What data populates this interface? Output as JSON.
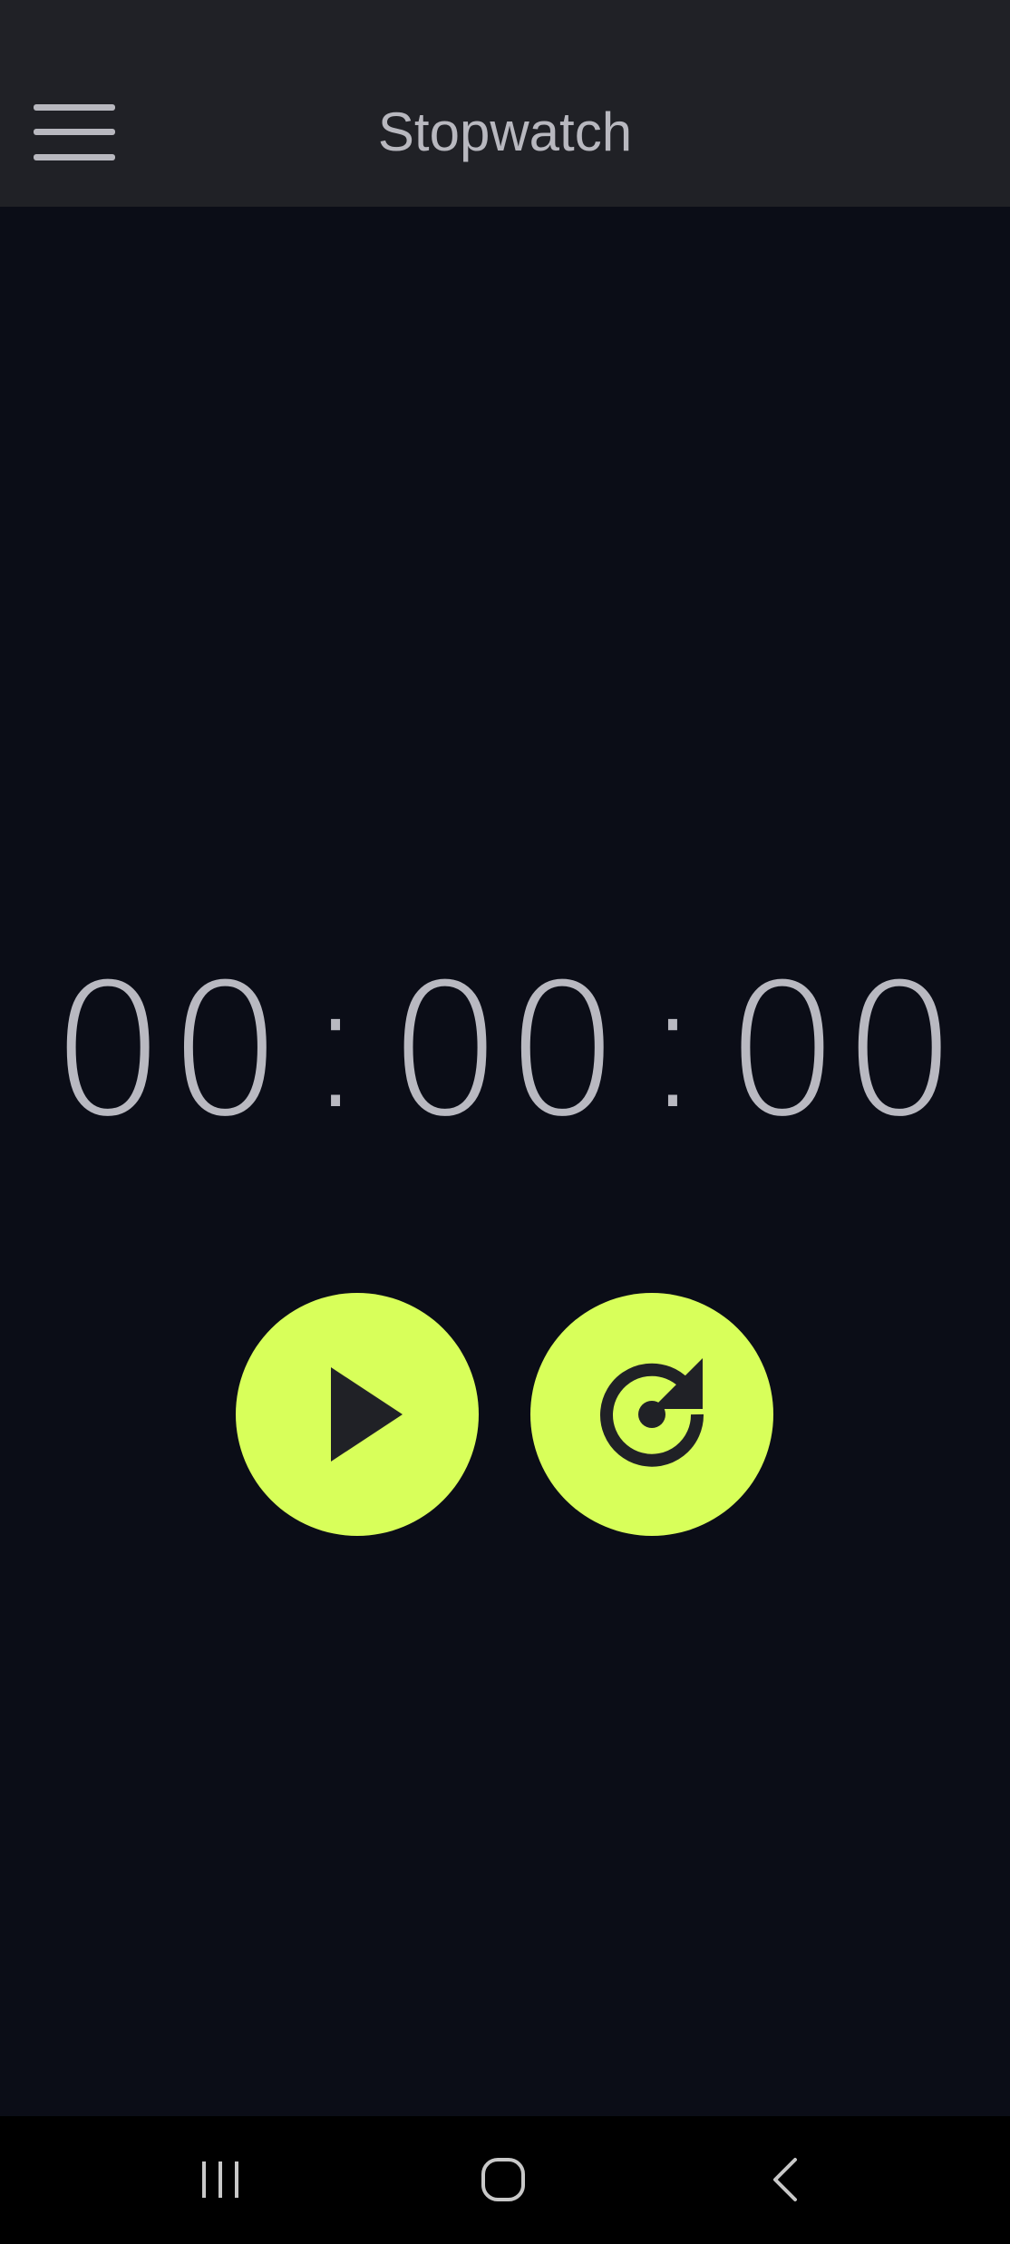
{
  "app_bar": {
    "title": "Stopwatch",
    "menu_icon": "hamburger-menu-icon"
  },
  "timer": {
    "hours": "00",
    "minutes": "00",
    "seconds": "00",
    "separator": ":"
  },
  "controls": {
    "play_icon": "play-icon",
    "reset_icon": "reset-icon"
  },
  "nav_bar": {
    "recents_icon": "recents-icon",
    "home_icon": "home-icon",
    "back_icon": "back-icon"
  },
  "colors": {
    "background": "#0b0d17",
    "app_bar": "#202126",
    "accent": "#d8ff5a",
    "text": "#b9b9c1",
    "icon_dark": "#202126"
  }
}
